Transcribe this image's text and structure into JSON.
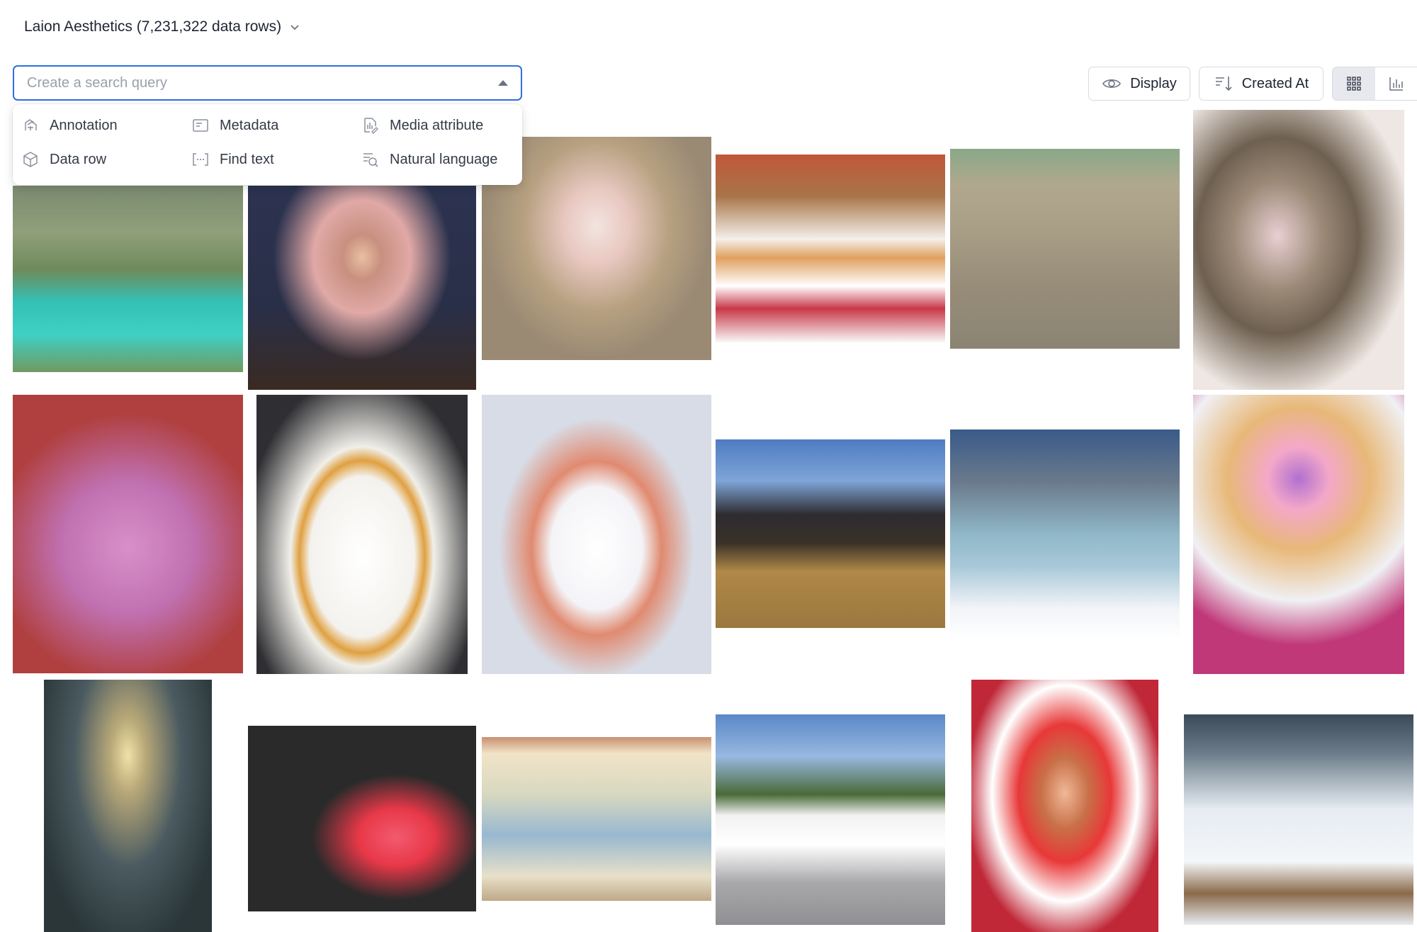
{
  "header": {
    "dataset_title": "Laion Aesthetics (7,231,322 data rows)"
  },
  "search": {
    "placeholder": "Create a search query",
    "value": ""
  },
  "filter_menu": {
    "items": [
      {
        "label": "Annotation",
        "icon": "annotation-icon"
      },
      {
        "label": "Metadata",
        "icon": "metadata-icon"
      },
      {
        "label": "Media attribute",
        "icon": "media-attribute-icon"
      },
      {
        "label": "Data row",
        "icon": "data-row-icon"
      },
      {
        "label": "Find text",
        "icon": "find-text-icon"
      },
      {
        "label": "Natural language",
        "icon": "natural-language-icon"
      }
    ]
  },
  "toolbar": {
    "display_label": "Display",
    "sort_label": "Created At",
    "view_modes": [
      "grid-view-icon",
      "chart-view-icon"
    ],
    "active_view": "grid-view-icon"
  },
  "colors": {
    "accent": "#2f6fe0",
    "border": "#d8dbe0",
    "text": "#1f2433",
    "placeholder": "#9aa0ab"
  },
  "gallery": {
    "rows": 3,
    "columns": 6,
    "tile_count": 18
  }
}
